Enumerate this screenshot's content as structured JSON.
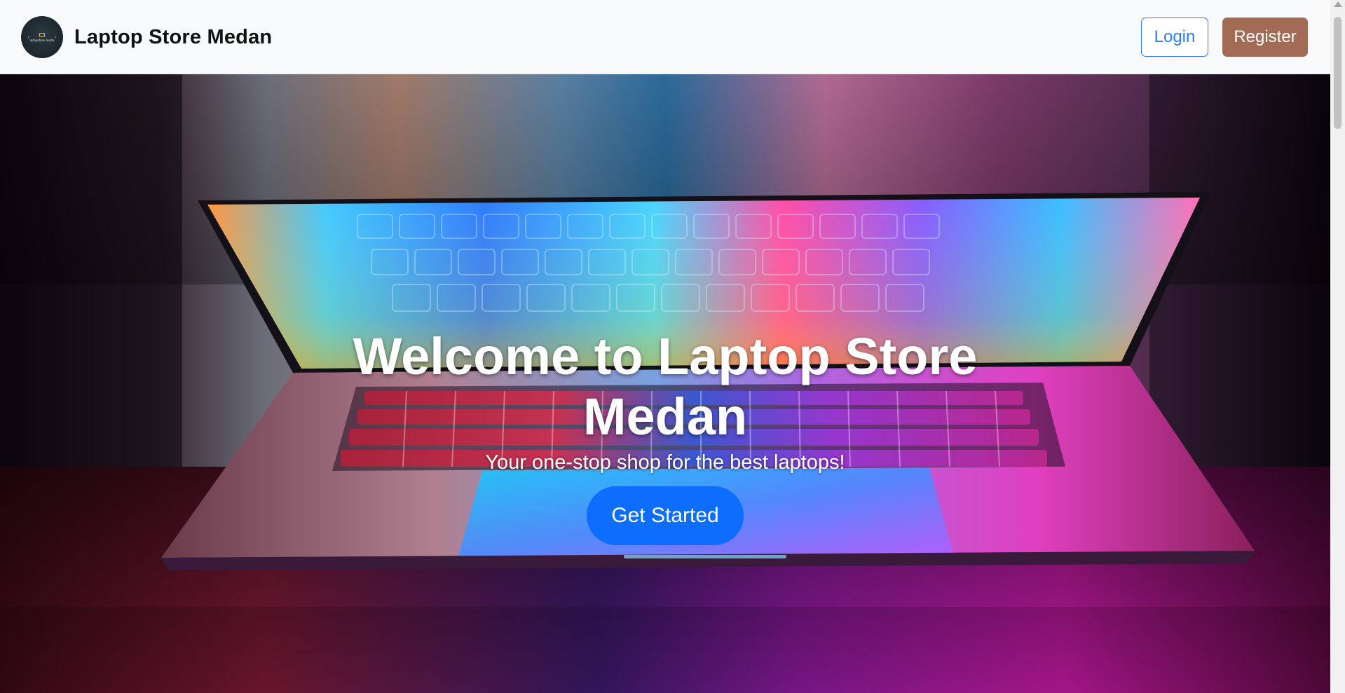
{
  "navbar": {
    "logo_text": "laptopstore medan",
    "brand_name": "Laptop Store Medan",
    "login_label": "Login",
    "register_label": "Register"
  },
  "hero": {
    "title": "Welcome to Laptop Store Medan",
    "subtitle": "Your one-stop shop for the best laptops!",
    "cta_label": "Get Started"
  },
  "colors": {
    "navbar_bg": "#f8f9fa",
    "login_border": "#2f7cf0",
    "register_bg": "#a16b55",
    "cta_bg": "#0d6efd"
  },
  "icons": {
    "logo": "laptop-store-logo",
    "scroll_up": "chevron-up-icon"
  }
}
